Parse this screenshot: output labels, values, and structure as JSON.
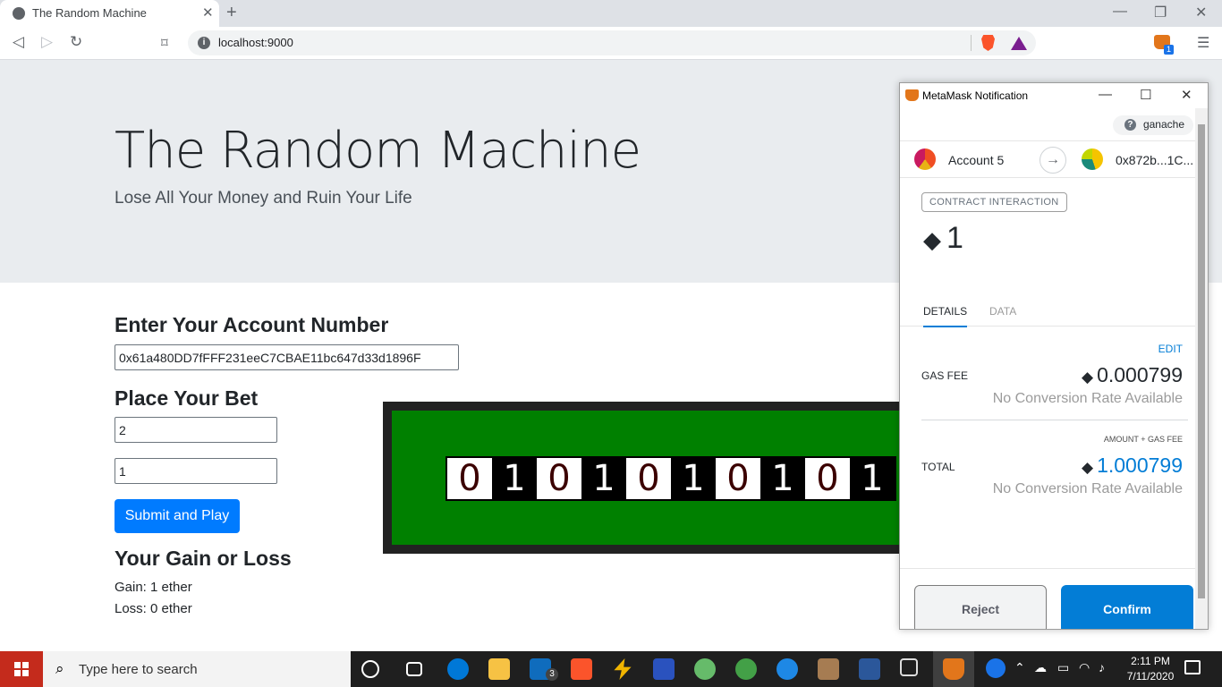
{
  "browser": {
    "tab_title": "The Random Machine",
    "tab_close": "✕",
    "new_tab": "+",
    "url": "localhost:9000",
    "info_glyph": "i",
    "extension_badge": "1",
    "window_controls": {
      "minimize": "—",
      "restore": "❐",
      "close": "✕"
    }
  },
  "page": {
    "title": "The Random Machine",
    "subtitle": "Lose All Your Money and Ruin Your Life",
    "account_heading": "Enter Your Account Number",
    "account_value": "0x61a480DD7fFFF231eeC7CBAE11bc647d33d1896F",
    "bet_heading": "Place Your Bet",
    "bet_value_1": "2",
    "bet_value_2": "1",
    "submit_label": "Submit and Play",
    "gain_loss_heading": "Your Gain or Loss",
    "gain_text": "Gain: 1 ether",
    "loss_text": "Loss: 0 ether",
    "digits": [
      "0",
      "1",
      "0",
      "1",
      "0",
      "1",
      "0",
      "1",
      "0",
      "1"
    ]
  },
  "metamask": {
    "window_title": "MetaMask Notification",
    "network": "ganache",
    "network_help": "?",
    "from_account": "Account 5",
    "to_account": "0x872b...1C...",
    "transaction_type": "CONTRACT INTERACTION",
    "eth_glyph": "◆",
    "amount": "1",
    "tabs": {
      "details": "DETAILS",
      "data": "DATA"
    },
    "edit_label": "EDIT",
    "gas_fee_label": "GAS FEE",
    "gas_fee_value": "0.000799",
    "no_conversion": "No Conversion Rate Available",
    "amount_plus_gas_label": "AMOUNT + GAS FEE",
    "total_label": "TOTAL",
    "total_value": "1.000799",
    "total_color": "#037dd6",
    "reject_label": "Reject",
    "confirm_label": "Confirm",
    "arrow_glyph": "→"
  },
  "taskbar": {
    "search_placeholder": "Type here to search",
    "mail_badge": "3",
    "time": "2:11 PM",
    "date": "7/11/2020",
    "icons": [
      "cortana-icon",
      "task-view-icon",
      "edge-icon",
      "file-explorer-icon",
      "mail-icon",
      "brave-icon",
      "lightning-icon",
      "malwarebytes-icon",
      "atom-icon",
      "atom-icon",
      "sync-icon",
      "box-icon",
      "powershell-icon",
      "terminal-icon",
      "metamask-icon"
    ]
  },
  "colors": {
    "primary_button": "#007bff",
    "machine_green": "#008000",
    "metamask_blue": "#037dd6",
    "start_red": "#c42b1c"
  }
}
